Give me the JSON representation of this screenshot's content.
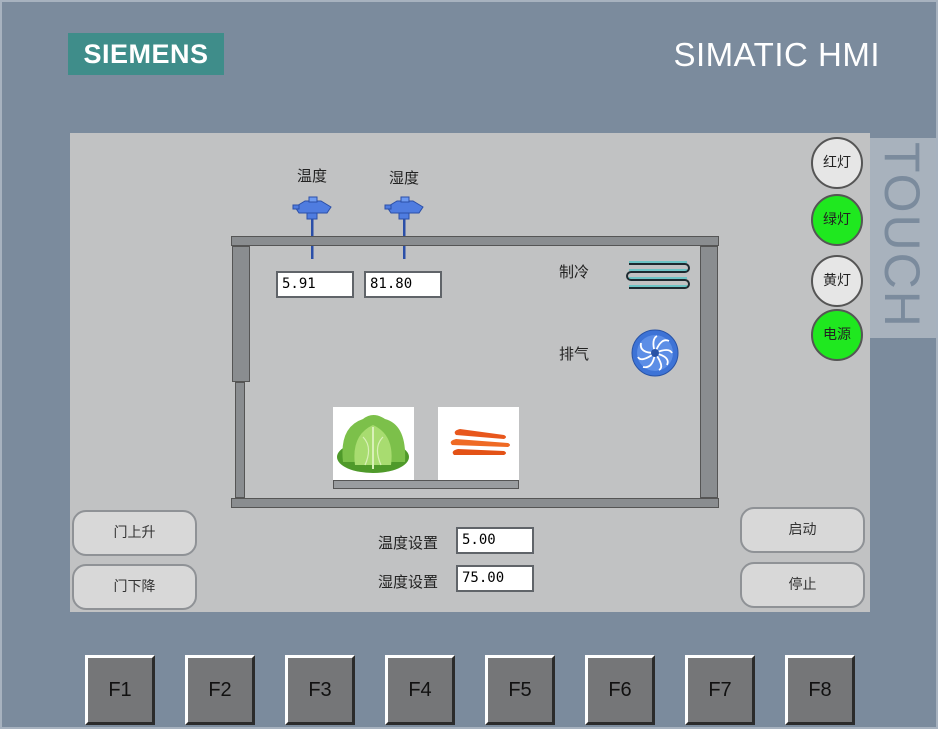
{
  "brand": {
    "logo": "SIEMENS",
    "model": "SIMATIC HMI",
    "touch": "TOUCH"
  },
  "sensors": {
    "temperature": {
      "label": "温度",
      "value": "5.91"
    },
    "humidity": {
      "label": "湿度",
      "value": "81.80"
    }
  },
  "devices": {
    "cooling_label": "制冷",
    "exhaust_label": "排气"
  },
  "lamps": [
    {
      "label": "红灯",
      "state": "off",
      "color": "#e6e6e6"
    },
    {
      "label": "绿灯",
      "state": "on",
      "color": "#1fe81f"
    },
    {
      "label": "黄灯",
      "state": "off",
      "color": "#e6e6e6"
    },
    {
      "label": "电源",
      "state": "on",
      "color": "#1fe81f"
    }
  ],
  "door_buttons": {
    "up": "门上升",
    "down": "门下降"
  },
  "control_buttons": {
    "start": "启动",
    "stop": "停止"
  },
  "setpoints": {
    "temperature": {
      "label": "温度设置",
      "value": "5.00"
    },
    "humidity": {
      "label": "湿度设置",
      "value": "75.00"
    }
  },
  "function_keys": [
    "F1",
    "F2",
    "F3",
    "F4",
    "F5",
    "F6",
    "F7",
    "F8"
  ],
  "items": {
    "lettuce": "lettuce-image",
    "carrot": "carrot-image"
  }
}
